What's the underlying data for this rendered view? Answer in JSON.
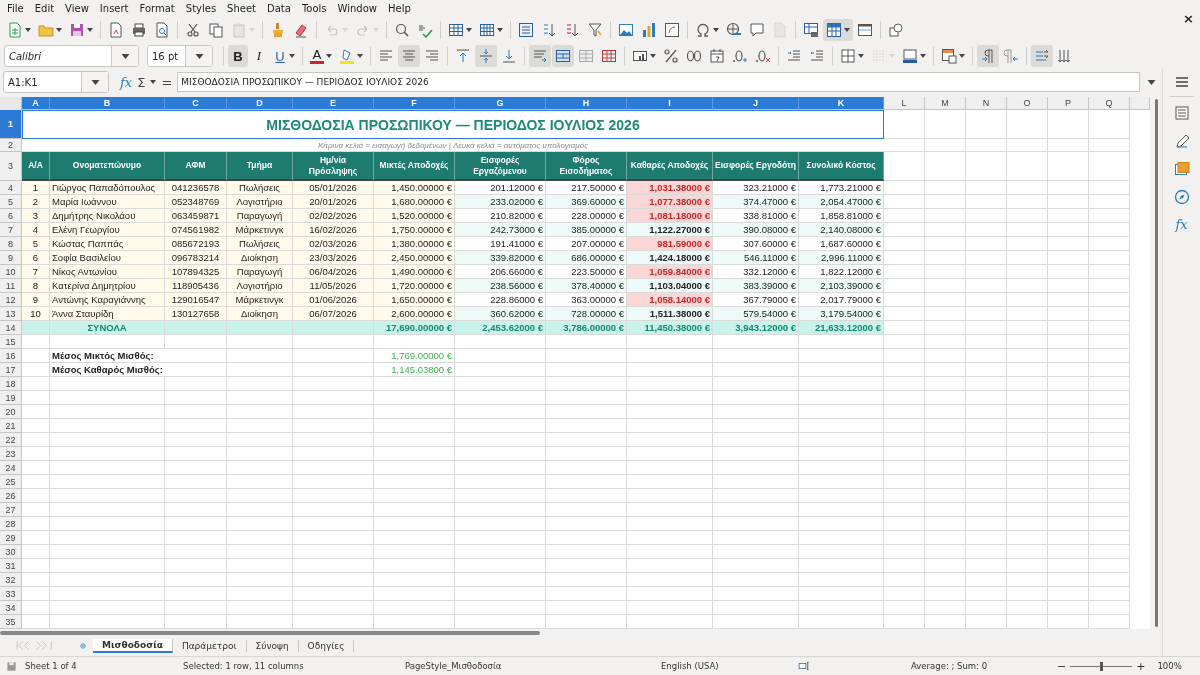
{
  "menu": [
    "File",
    "Edit",
    "View",
    "Insert",
    "Format",
    "Styles",
    "Sheet",
    "Data",
    "Tools",
    "Window",
    "Help"
  ],
  "close_document": "×",
  "standard_toolbar": [
    [
      {
        "kind": "new-spreadsheet",
        "selected": false,
        "disabled": false,
        "dropdown": true
      },
      {
        "kind": "folder",
        "selected": false,
        "disabled": false,
        "dropdown": true
      },
      {
        "kind": "floppy-disk",
        "selected": false,
        "disabled": false,
        "dropdown": true
      }
    ],
    [
      {
        "kind": "pdf-page",
        "selected": false,
        "disabled": false,
        "dropdown": false
      },
      {
        "kind": "printer",
        "selected": false,
        "disabled": false,
        "dropdown": false
      },
      {
        "kind": "page-magnifier",
        "selected": false,
        "disabled": false,
        "dropdown": false
      }
    ],
    [
      {
        "kind": "scissors",
        "selected": false,
        "disabled": false,
        "dropdown": false
      },
      {
        "kind": "copy-pages",
        "selected": false,
        "disabled": false,
        "dropdown": false
      },
      {
        "kind": "clipboard",
        "selected": false,
        "disabled": true,
        "dropdown": true
      }
    ],
    [
      {
        "kind": "paintbrush",
        "selected": false,
        "disabled": false,
        "dropdown": false
      },
      {
        "kind": "eraser",
        "selected": false,
        "disabled": false,
        "dropdown": false
      }
    ],
    [
      {
        "kind": "undo-arrow",
        "selected": false,
        "disabled": true,
        "dropdown": true
      },
      {
        "kind": "redo-arrow",
        "selected": false,
        "disabled": true,
        "dropdown": true
      }
    ],
    [
      {
        "kind": "magnifier",
        "selected": false,
        "disabled": false,
        "dropdown": false
      },
      {
        "kind": "check-mark",
        "selected": false,
        "disabled": false,
        "dropdown": false
      }
    ],
    [
      {
        "kind": "table-rows",
        "selected": false,
        "disabled": false,
        "dropdown": true
      },
      {
        "kind": "table-columns",
        "selected": false,
        "disabled": false,
        "dropdown": true
      }
    ],
    [
      {
        "kind": "sort-lines",
        "selected": false,
        "disabled": false,
        "dropdown": false
      },
      {
        "kind": "sort-ascending",
        "selected": false,
        "disabled": false,
        "dropdown": false
      },
      {
        "kind": "sort-descending",
        "selected": false,
        "disabled": false,
        "dropdown": false
      },
      {
        "kind": "funnel",
        "selected": false,
        "disabled": false,
        "dropdown": false
      }
    ],
    [
      {
        "kind": "image",
        "selected": false,
        "disabled": false,
        "dropdown": false
      },
      {
        "kind": "bar-chart",
        "selected": false,
        "disabled": false,
        "dropdown": false
      },
      {
        "kind": "pivot-table",
        "selected": false,
        "disabled": false,
        "dropdown": false
      }
    ],
    [
      {
        "kind": "omega",
        "selected": false,
        "disabled": false,
        "dropdown": true
      },
      {
        "kind": "globe",
        "selected": false,
        "disabled": false,
        "dropdown": false
      },
      {
        "kind": "speech-bubble",
        "selected": false,
        "disabled": false,
        "dropdown": false
      },
      {
        "kind": "blank-page",
        "selected": false,
        "disabled": true,
        "dropdown": false
      }
    ],
    [
      {
        "kind": "print-table",
        "selected": false,
        "disabled": false,
        "dropdown": false
      },
      {
        "kind": "freeze-table",
        "selected": true,
        "disabled": false,
        "dropdown": true
      },
      {
        "kind": "split-window",
        "selected": false,
        "disabled": false,
        "dropdown": false
      }
    ],
    [
      {
        "kind": "shapes",
        "selected": false,
        "disabled": false,
        "dropdown": false
      }
    ]
  ],
  "font_name": "Calibri",
  "font_size": "16 pt",
  "format_toolbar": [
    [
      {
        "kind": "letter",
        "label": "B",
        "selected": true,
        "disabled": false,
        "dropdown": false
      },
      {
        "kind": "letter",
        "label": "I",
        "selected": false,
        "disabled": false,
        "dropdown": false
      },
      {
        "kind": "letter",
        "label": "U",
        "selected": false,
        "disabled": false,
        "dropdown": true
      }
    ],
    [
      {
        "kind": "font-color",
        "label": "A",
        "selected": false,
        "disabled": false,
        "dropdown": true
      },
      {
        "kind": "highlighter",
        "selected": false,
        "disabled": false,
        "dropdown": true
      }
    ],
    [
      {
        "kind": "align-left",
        "selected": false,
        "disabled": false,
        "dropdown": false
      },
      {
        "kind": "align-center",
        "selected": true,
        "disabled": false,
        "dropdown": false
      },
      {
        "kind": "align-right",
        "selected": false,
        "disabled": false,
        "dropdown": false
      }
    ],
    [
      {
        "kind": "align-top",
        "selected": false,
        "disabled": false,
        "dropdown": false
      },
      {
        "kind": "align-middle",
        "selected": true,
        "disabled": false,
        "dropdown": false
      },
      {
        "kind": "align-bottom",
        "selected": false,
        "disabled": false,
        "dropdown": false
      }
    ],
    [
      {
        "kind": "wrap-lines",
        "selected": true,
        "disabled": false,
        "dropdown": false
      },
      {
        "kind": "merge-table",
        "selected": true,
        "disabled": false,
        "dropdown": false
      },
      {
        "kind": "grey-table",
        "selected": false,
        "disabled": false,
        "dropdown": false
      },
      {
        "kind": "red-table",
        "selected": false,
        "disabled": false,
        "dropdown": false
      }
    ],
    [
      {
        "kind": "number-format",
        "selected": false,
        "disabled": false,
        "dropdown": true
      },
      {
        "kind": "percent",
        "selected": false,
        "disabled": false,
        "dropdown": false
      },
      {
        "kind": "decimal-zero",
        "selected": false,
        "disabled": false,
        "dropdown": false
      },
      {
        "kind": "calendar",
        "selected": false,
        "disabled": false,
        "dropdown": false
      },
      {
        "kind": "add-decimal",
        "selected": false,
        "disabled": false,
        "dropdown": false
      },
      {
        "kind": "delete-decimal",
        "selected": false,
        "disabled": false,
        "dropdown": false
      }
    ],
    [
      {
        "kind": "indent-increase",
        "selected": false,
        "disabled": false,
        "dropdown": false
      },
      {
        "kind": "indent-decrease",
        "selected": false,
        "disabled": false,
        "dropdown": false
      }
    ],
    [
      {
        "kind": "borders",
        "selected": false,
        "disabled": false,
        "dropdown": true
      },
      {
        "kind": "border-style",
        "selected": false,
        "disabled": true,
        "dropdown": true
      },
      {
        "kind": "border-color",
        "selected": false,
        "disabled": false,
        "dropdown": true
      }
    ],
    [
      {
        "kind": "conditional-table",
        "selected": false,
        "disabled": false,
        "dropdown": true
      }
    ],
    [
      {
        "kind": "paragraph-ltr",
        "selected": true,
        "disabled": false,
        "dropdown": false
      },
      {
        "kind": "paragraph-rtl",
        "selected": false,
        "disabled": false,
        "dropdown": false
      }
    ],
    [
      {
        "kind": "text-arrows",
        "selected": true,
        "disabled": false,
        "dropdown": false
      },
      {
        "kind": "down-arrows",
        "selected": false,
        "disabled": false,
        "dropdown": false
      }
    ]
  ],
  "formula_bar": {
    "name_box": "A1:K1",
    "function_symbol": "fx",
    "sum_symbol": "Σ",
    "equals_symbol": "=",
    "content": "ΜΙΣΘΟΔΟΣΙΑ ΠΡΟΣΩΠΙΚΟΥ — ΠΕΡΙΟΔΟΣ ΙΟΥΛΙΟΣ 2026"
  },
  "columns": [
    {
      "label": "A",
      "selected": true
    },
    {
      "label": "B",
      "selected": true
    },
    {
      "label": "C",
      "selected": true
    },
    {
      "label": "D",
      "selected": true
    },
    {
      "label": "E",
      "selected": true
    },
    {
      "label": "F",
      "selected": true
    },
    {
      "label": "G",
      "selected": true
    },
    {
      "label": "H",
      "selected": true
    },
    {
      "label": "I",
      "selected": true
    },
    {
      "label": "J",
      "selected": true
    },
    {
      "label": "K",
      "selected": true
    },
    {
      "label": "L",
      "selected": false
    },
    {
      "label": "M",
      "selected": false
    },
    {
      "label": "N",
      "selected": false
    },
    {
      "label": "O",
      "selected": false
    },
    {
      "label": "P",
      "selected": false
    },
    {
      "label": "Q",
      "selected": false
    }
  ],
  "row_headers": [
    {
      "label": "1",
      "selected": true
    },
    {
      "label": "2",
      "selected": false
    },
    {
      "label": "3",
      "selected": false
    },
    {
      "label": "4",
      "selected": false
    },
    {
      "label": "5",
      "selected": false
    },
    {
      "label": "6",
      "selected": false
    },
    {
      "label": "7",
      "selected": false
    },
    {
      "label": "8",
      "selected": false
    },
    {
      "label": "9",
      "selected": false
    },
    {
      "label": "10",
      "selected": false
    },
    {
      "label": "11",
      "selected": false
    },
    {
      "label": "12",
      "selected": false
    },
    {
      "label": "13",
      "selected": false
    },
    {
      "label": "14",
      "selected": false
    },
    {
      "label": "15",
      "selected": false
    },
    {
      "label": "16",
      "selected": false
    },
    {
      "label": "17",
      "selected": false
    },
    {
      "label": "18",
      "selected": false
    },
    {
      "label": "19",
      "selected": false
    },
    {
      "label": "20",
      "selected": false
    },
    {
      "label": "21",
      "selected": false
    },
    {
      "label": "22",
      "selected": false
    },
    {
      "label": "23",
      "selected": false
    },
    {
      "label": "24",
      "selected": false
    },
    {
      "label": "25",
      "selected": false
    },
    {
      "label": "26",
      "selected": false
    },
    {
      "label": "27",
      "selected": false
    },
    {
      "label": "28",
      "selected": false
    },
    {
      "label": "29",
      "selected": false
    },
    {
      "label": "30",
      "selected": false
    },
    {
      "label": "31",
      "selected": false
    },
    {
      "label": "32",
      "selected": false
    },
    {
      "label": "33",
      "selected": false
    },
    {
      "label": "34",
      "selected": false
    },
    {
      "label": "35",
      "selected": false
    }
  ],
  "sheet": {
    "title": "ΜΙΣΘΟΔΟΣΙΑ ΠΡΟΣΩΠΙΚΟΥ — ΠΕΡΙΟΔΟΣ ΙΟΥΛΙΟΣ 2026",
    "subtitle": "Κίτρινα κελιά = εισαγωγή δεδομένων | Λευκά κελιά = αυτόματος υπολογισμός",
    "headers": [
      "Α/Α",
      "Ονοματεπώνυμο",
      "ΑΦΜ",
      "Τμήμα",
      "Ημ/νία Πρόσληψης",
      "Μικτές Αποδοχές",
      "Εισφορές Εργαζόμενου",
      "Φόρος Εισοδήματος",
      "Καθαρές Αποδοχές",
      "Εισφορές Εργοδότη",
      "Συνολικό Κόστος"
    ],
    "rows": [
      {
        "cells": [
          "1",
          "Γιώργος Παπαδόπουλος",
          "041236578",
          "Πωλήσεις",
          "05/01/2026",
          "1,450.00000 €",
          "201.12000 €",
          "217.50000 €",
          "1,031.38000 €",
          "323.21000 €",
          "1,773.21000 €"
        ],
        "low_net": true
      },
      {
        "cells": [
          "2",
          "Μαρία Ιωάννου",
          "052348769",
          "Λογιστήριο",
          "20/01/2026",
          "1,680.00000 €",
          "233.02000 €",
          "369.60000 €",
          "1,077.38000 €",
          "374.47000 €",
          "2,054.47000 €"
        ],
        "low_net": true
      },
      {
        "cells": [
          "3",
          "Δημήτρης Νικολάου",
          "063459871",
          "Παραγωγή",
          "02/02/2026",
          "1,520.00000 €",
          "210.82000 €",
          "228.00000 €",
          "1,081.18000 €",
          "338.81000 €",
          "1,858.81000 €"
        ],
        "low_net": true
      },
      {
        "cells": [
          "4",
          "Ελένη Γεωργίου",
          "074561982",
          "Μάρκετινγκ",
          "16/02/2026",
          "1,750.00000 €",
          "242.73000 €",
          "385.00000 €",
          "1,122.27000 €",
          "390.08000 €",
          "2,140.08000 €"
        ],
        "low_net": false
      },
      {
        "cells": [
          "5",
          "Κώστας Παππάς",
          "085672193",
          "Πωλήσεις",
          "02/03/2026",
          "1,380.00000 €",
          "191.41000 €",
          "207.00000 €",
          "981.59000 €",
          "307.60000 €",
          "1,687.60000 €"
        ],
        "low_net": true
      },
      {
        "cells": [
          "6",
          "Σοφία Βασιλείου",
          "096783214",
          "Διοίκηση",
          "23/03/2026",
          "2,450.00000 €",
          "339.82000 €",
          "686.00000 €",
          "1,424.18000 €",
          "546.11000 €",
          "2,996.11000 €"
        ],
        "low_net": false
      },
      {
        "cells": [
          "7",
          "Νίκος Αντωνίου",
          "107894325",
          "Παραγωγή",
          "06/04/2026",
          "1,490.00000 €",
          "206.66000 €",
          "223.50000 €",
          "1,059.84000 €",
          "332.12000 €",
          "1,822.12000 €"
        ],
        "low_net": true
      },
      {
        "cells": [
          "8",
          "Κατερίνα Δημητρίου",
          "118905436",
          "Λογιστήριο",
          "11/05/2026",
          "1,720.00000 €",
          "238.56000 €",
          "378.40000 €",
          "1,103.04000 €",
          "383.39000 €",
          "2,103.39000 €"
        ],
        "low_net": false
      },
      {
        "cells": [
          "9",
          "Αντώνης Καραγιάννης",
          "129016547",
          "Μάρκετινγκ",
          "01/06/2026",
          "1,650.00000 €",
          "228.86000 €",
          "363.00000 €",
          "1,058.14000 €",
          "367.79000 €",
          "2,017.79000 €"
        ],
        "low_net": true
      },
      {
        "cells": [
          "10",
          "Άννα Σταυρίδη",
          "130127658",
          "Διοίκηση",
          "06/07/2026",
          "2,600.00000 €",
          "360.62000 €",
          "728.00000 €",
          "1,511.38000 €",
          "579.54000 €",
          "3,179.54000 €"
        ],
        "low_net": false
      }
    ],
    "totals": {
      "label": "ΣΥΝΟΛΑ",
      "values": [
        "17,690.00000 €",
        "2,453.62000 €",
        "3,786.00000 €",
        "11,450.38000 €",
        "3,943.12000 €",
        "21,633.12000 €"
      ]
    },
    "averages": [
      {
        "label": "Μέσος Μικτός Μισθός:",
        "value": "1,769.00000 €"
      },
      {
        "label": "Μέσος Καθαρός Μισθός:",
        "value": "1,145.03800 €"
      }
    ]
  },
  "sidebar": {
    "functions_label": "fx"
  },
  "sheet_tabs": [
    {
      "label": "Μισθοδοσία",
      "selected": true
    },
    {
      "label": "Παράμετροι",
      "selected": false
    },
    {
      "label": "Σύνοψη",
      "selected": false
    },
    {
      "label": "Οδηγίες",
      "selected": false
    }
  ],
  "status_bar": {
    "sheet": "Sheet 1 of 4",
    "selection": "Selected: 1 row, 11 columns",
    "page_style": "PageStyle_Μισθοδοσία",
    "language": "English (USA)",
    "summary": "Average: ; Sum: 0",
    "zoom_out": "−",
    "zoom_in": "+",
    "zoom": {
      "level": 0.5
    },
    "zoom_label": "100%"
  }
}
